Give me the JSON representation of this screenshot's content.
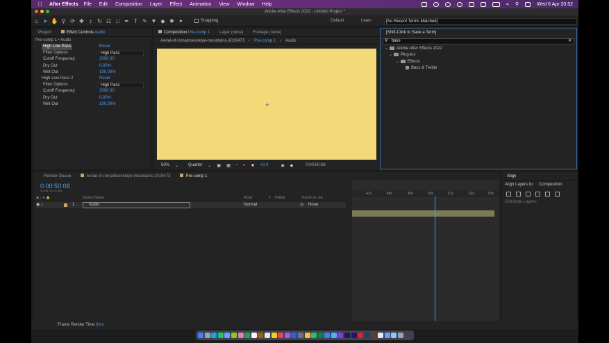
{
  "menubar": {
    "app": "After Effects",
    "items": [
      "File",
      "Edit",
      "Composition",
      "Layer",
      "Effect",
      "Animation",
      "View",
      "Window",
      "Help"
    ],
    "clock": "Wed 6 Apr  20:52"
  },
  "window": {
    "title": "Adobe After Effects 2022 - Untitled Project *"
  },
  "toolbar": {
    "snapping_label": "Snapping",
    "workspaces": [
      "Default",
      "Learn"
    ],
    "help_search": "[No Recent Terms Matched]"
  },
  "project_panel": {
    "tabs": [
      "Project",
      "Effect Controls",
      "Audio"
    ],
    "subtitle": "Pre-comp 1 • Audio",
    "effects": [
      {
        "name": "High Low Pass",
        "reset": "Reset",
        "filter_label": "Filter Options",
        "filter_value": "High Pass",
        "cutoff_label": "Cutoff Frequency",
        "cutoff_value": "2000.00",
        "dry_label": "Dry Out",
        "dry_value": "0.00%",
        "wet_label": "Wet Out",
        "wet_value": "100.00%"
      },
      {
        "name": "High-Low Pass 2",
        "reset": "Reset",
        "filter_label": "Filter Options",
        "filter_value": "High Pass",
        "cutoff_label": "Cutoff Frequency",
        "cutoff_value": "2000.00",
        "dry_label": "Dry Out",
        "dry_value": "0.00%",
        "wet_label": "Wet Out",
        "wet_value": "100.00%"
      }
    ]
  },
  "comp_panel": {
    "tab_prefix": "Composition",
    "tab_name": "Pre-comp 1",
    "layer_tab": "Layer (none)",
    "footage_tab": "Footage (none)",
    "crumbs": [
      "Aerial-of-romantsevskiye-mountains-1019473",
      "Pre-comp 1",
      "Audio"
    ],
    "zoom": "50%",
    "resolution": "Quarter",
    "exposure": "+0.0",
    "timecode": "0:00:50:08"
  },
  "effects_panel": {
    "hint": "[Shift-Click to Save a Term]",
    "search": "bass",
    "tree": [
      "Adobe After Effects 2022",
      "Plug-ins",
      "Effects",
      "Bass & Treble"
    ]
  },
  "timeline": {
    "tabs": [
      "Render Queue",
      "Aerial-of-romantsevskiye-mountains-1019473",
      "Pre-comp 1"
    ],
    "timecode": "0:00:50:08",
    "fps": "01508 (30.00 fps)",
    "columns": [
      "Source Name",
      "Mode",
      "T",
      "TrkMat",
      "Parent & Link"
    ],
    "layer": {
      "index": "1",
      "name": "Audio",
      "mode": "Normal",
      "parent": "None"
    },
    "ruler": [
      "47s",
      "48s",
      "49s",
      "50s",
      "51s",
      "52s",
      "53s"
    ]
  },
  "align_panel": {
    "title": "Align",
    "align_to_label": "Align Layers to:",
    "align_to_value": "Composition",
    "distribute_label": "Distribute Layers:"
  },
  "statusbar": {
    "label": "Frame Render Time",
    "value": "3ms"
  },
  "colors": {
    "accent": "#4a9ff5",
    "canvas": "#f4d978",
    "menubar": "#6a2f7a",
    "clip": "#7d7a56"
  }
}
